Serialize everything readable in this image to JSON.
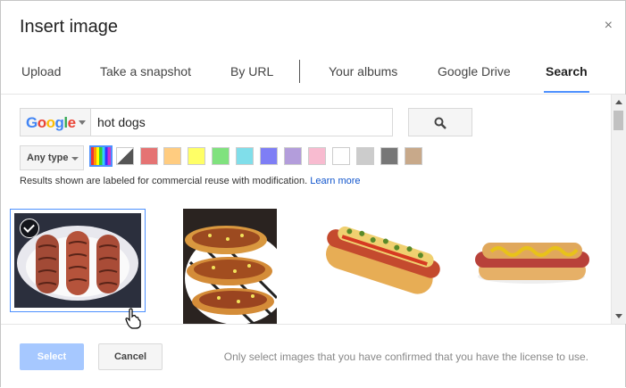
{
  "dialog": {
    "title": "Insert image",
    "close_glyph": "×"
  },
  "tabs": [
    {
      "label": "Upload"
    },
    {
      "label": "Take a snapshot"
    },
    {
      "label": "By URL"
    },
    {
      "label": "Your albums"
    },
    {
      "label": "Google Drive"
    },
    {
      "label": "Search",
      "active": true
    }
  ],
  "search": {
    "engine_label_parts": [
      "G",
      "o",
      "o",
      "g",
      "l",
      "e"
    ],
    "engine_colors": [
      "#4285f4",
      "#ea4335",
      "#fbbc05",
      "#4285f4",
      "#34a853",
      "#ea4335"
    ],
    "query": "hot dogs",
    "button_icon": "search-icon"
  },
  "filters": {
    "type_label": "Any type",
    "colors": [
      "full-color",
      "black-and-white",
      "#e57373",
      "#ffcc80",
      "#ffff66",
      "#80e27e",
      "#80deea",
      "#7e7ef5",
      "#b39ddb",
      "#f8bbd0",
      "#ffffff",
      "#cccccc",
      "#777777",
      "#c8a98a"
    ],
    "selected_color": "full-color"
  },
  "license": {
    "text": "Results shown are labeled for commercial reuse with modification.",
    "link": "Learn more"
  },
  "results": [
    {
      "subject": "three grilled sausages",
      "selected": true
    },
    {
      "subject": "chili cheese hot dogs on striped plate",
      "selected": false
    },
    {
      "subject": "hot dog with relish and mustard",
      "selected": false
    },
    {
      "subject": "hot dog with mustard",
      "selected": false
    }
  ],
  "footer": {
    "select_label": "Select",
    "cancel_label": "Cancel",
    "note": "Only select images that you have confirmed that you have the license to use."
  }
}
